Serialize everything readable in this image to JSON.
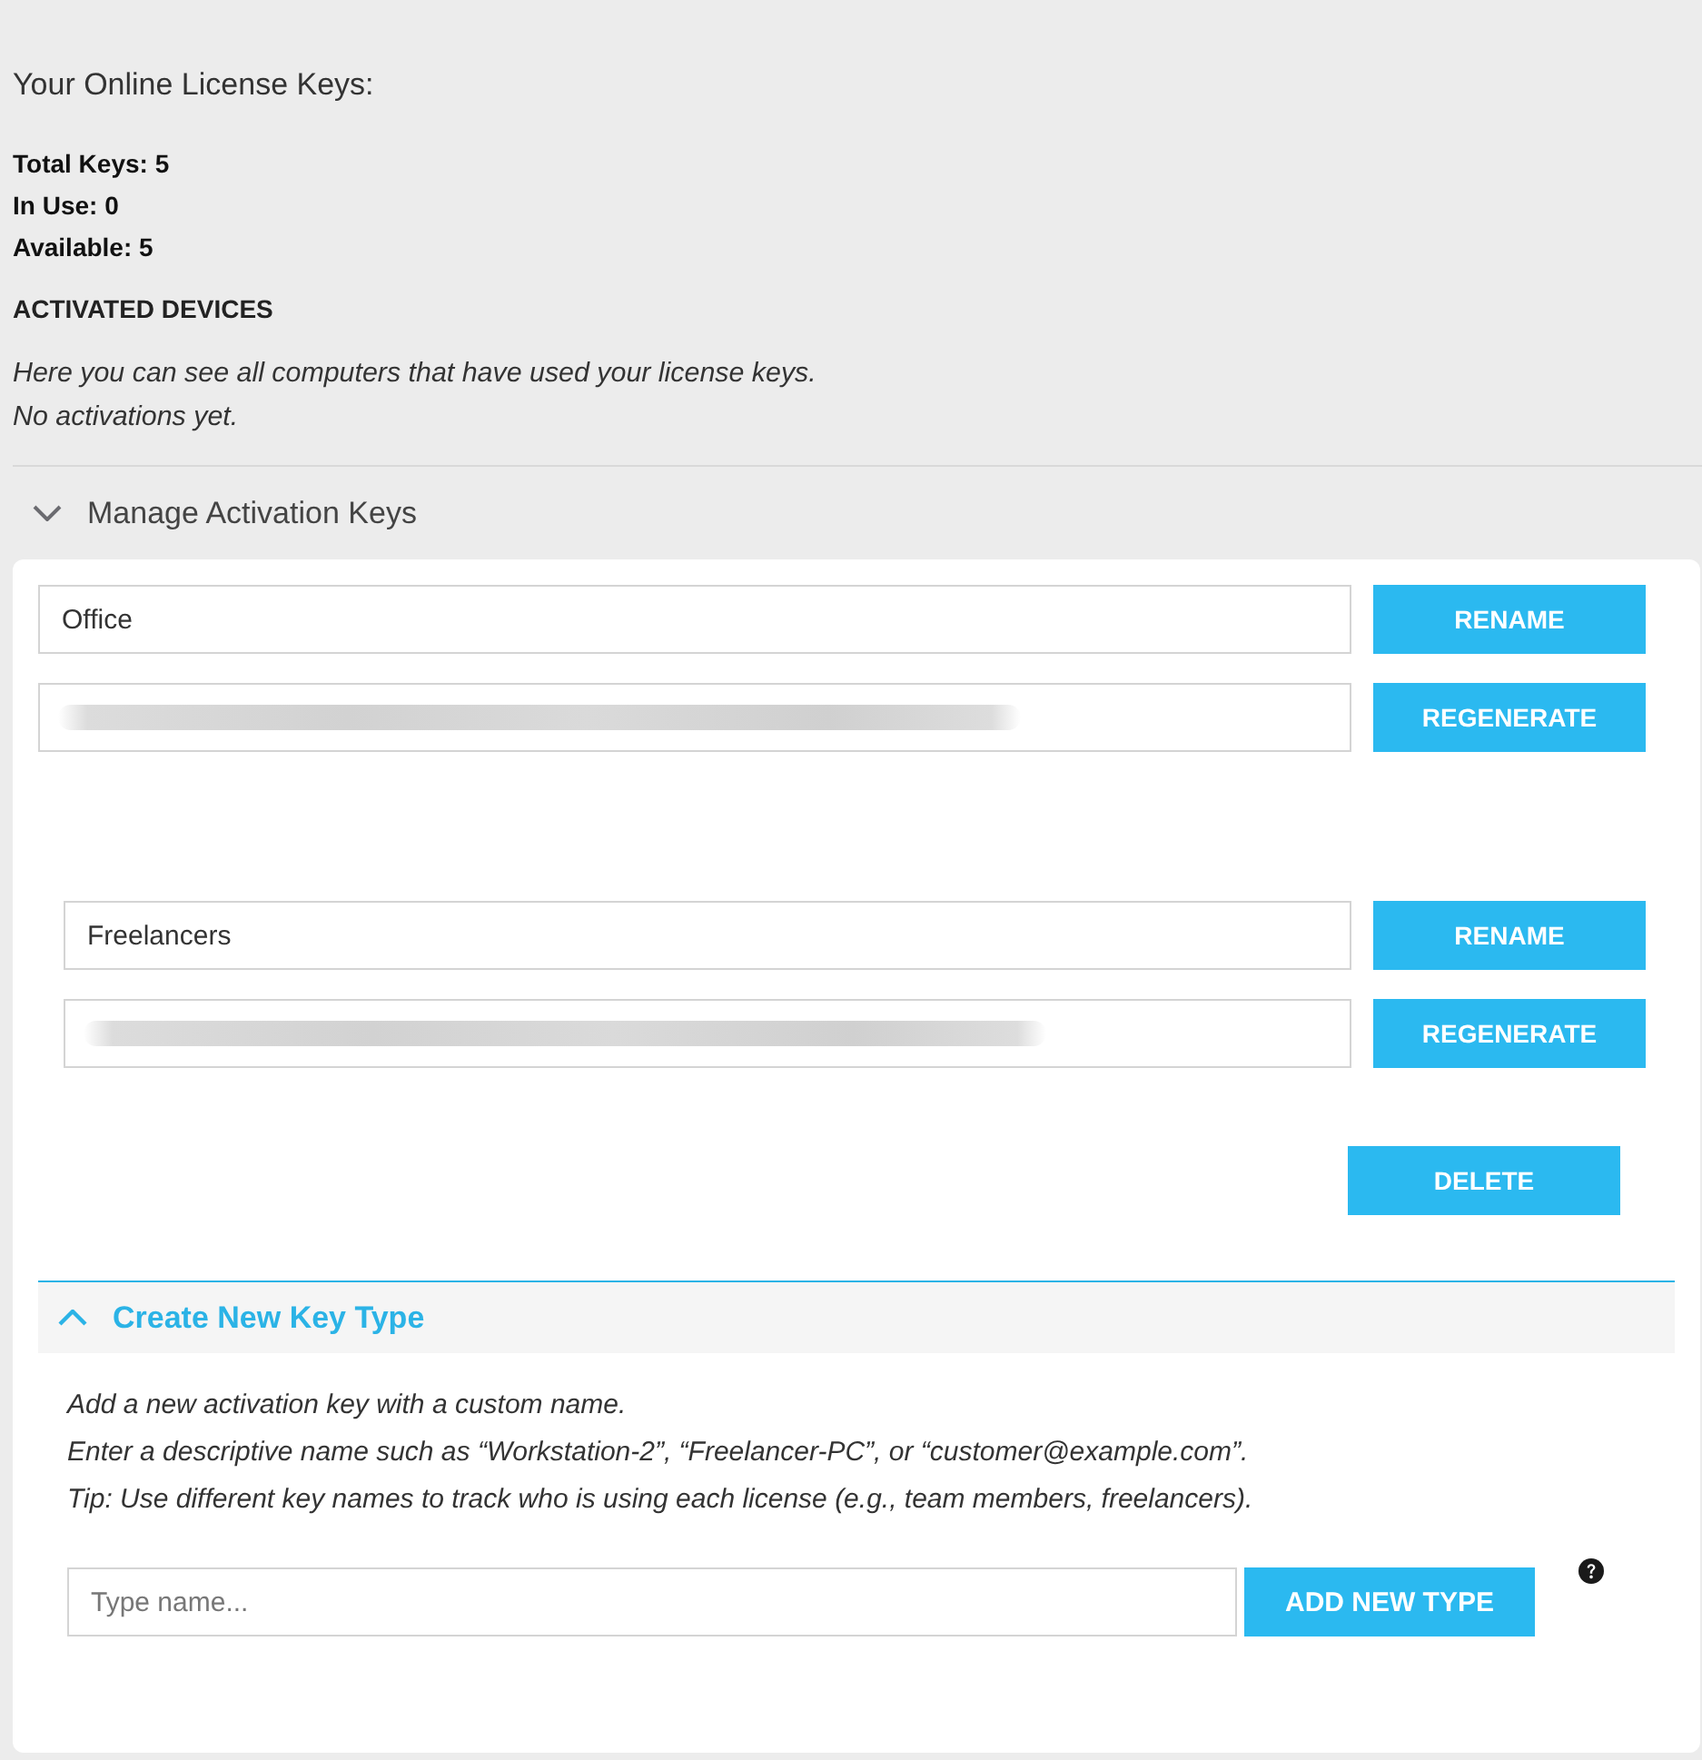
{
  "summary": {
    "title": "Your Online License Keys:",
    "stats": [
      "Total Keys: 5",
      "In Use: 0",
      "Available: 5"
    ]
  },
  "activated_devices": {
    "heading": "ACTIVATED DEVICES",
    "lines": [
      "Here you can see all computers that have used your license keys.",
      "No activations yet."
    ]
  },
  "manage_section": {
    "title": "Manage Activation Keys",
    "key_groups": [
      {
        "name": "Office",
        "indented": false,
        "rename_button": "RENAME",
        "key_field": {
          "blurred": true
        },
        "regenerate_button": "REGENERATE"
      },
      {
        "name": "Freelancers",
        "indented": true,
        "rename_button": "RENAME",
        "key_field": {
          "blurred": true
        },
        "regenerate_button": "REGENERATE",
        "delete_button": "DELETE"
      }
    ]
  },
  "create_section": {
    "title": "Create New Key Type",
    "lines": [
      "Add a new activation key with a custom name.",
      "Enter a descriptive name such as “Workstation-2”, “Freelancer-PC”, or “customer@example.com”.",
      "Tip: Use different key names to track who is using each license (e.g., team members, freelancers)."
    ],
    "name_field": {
      "placeholder": "Type name..."
    },
    "add_button": "ADD NEW TYPE"
  }
}
